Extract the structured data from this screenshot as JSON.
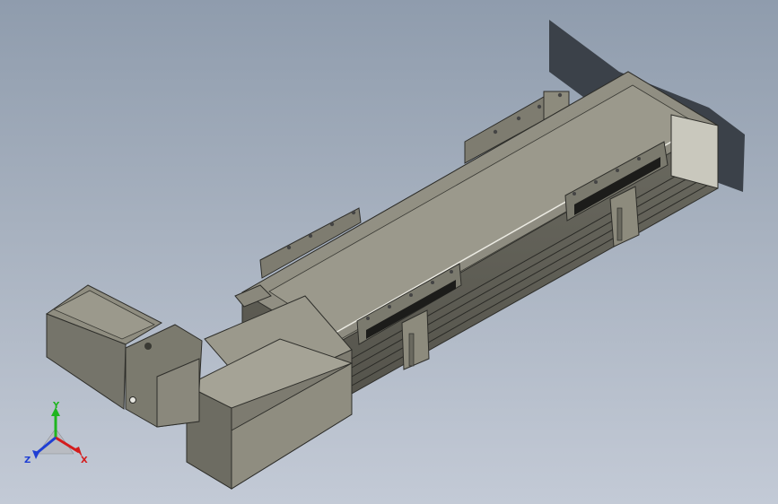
{
  "viewport": {
    "background_top": "#8f9cad",
    "background_bottom": "#c3cad6",
    "model_color": "#8d8b7d",
    "edge_color": "#2e2e2a"
  },
  "triad": {
    "x_label": "X",
    "y_label": "Y",
    "z_label": "Z",
    "x_color": "#d41c1c",
    "y_color": "#1fb51f",
    "z_color": "#1f3fd4"
  }
}
